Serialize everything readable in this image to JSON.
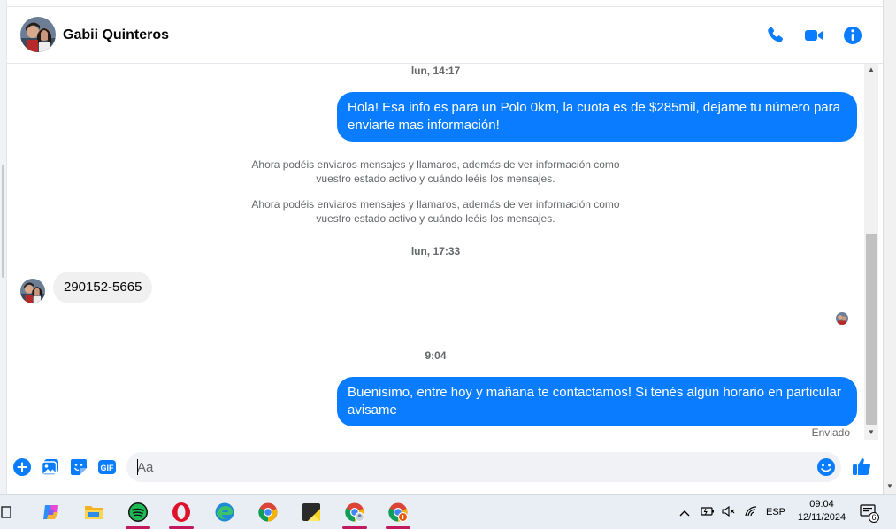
{
  "header": {
    "contact_name": "Gabii Quinteros",
    "accent_color": "#0a7cff",
    "icons": [
      "phone-icon",
      "video-camera-icon",
      "info-icon"
    ]
  },
  "conversation": {
    "timestamp_1": "lun, 14:17",
    "message_out_1": "Hola! Esa info es para un Polo 0km, la cuota es de $285mil, dejame tu número para enviarte mas información!",
    "system_1_line1": "Ahora podéis enviaros mensajes y llamaros, además de ver información como",
    "system_1_line2": "vuestro estado activo y cuándo leéis los mensajes.",
    "system_2_line1": "Ahora podéis enviaros mensajes y llamaros, además de ver información como",
    "system_2_line2": "vuestro estado activo y cuándo leéis los mensajes.",
    "timestamp_2": "lun, 17:33",
    "message_in_1": "290152-5665",
    "timestamp_3": "9:04",
    "message_out_2": "Buenisimo, entre hoy y mañana te contactamos! Si tenés algún horario en particular avisame",
    "status": "Enviado"
  },
  "composer": {
    "placeholder": "Aa",
    "buttons": [
      "plus-icon",
      "image-icon",
      "sticker-icon",
      "gif-icon",
      "emoji-icon",
      "like-icon"
    ],
    "gif_label": "GIF"
  },
  "taskbar": {
    "apps": [
      "task-view-icon",
      "copilot-icon",
      "file-explorer-icon",
      "spotify-icon",
      "opera-icon",
      "edge-icon",
      "chrome-icon",
      "sticky-notes-icon",
      "chrome-profile-1-icon",
      "chrome-profile-2-icon"
    ],
    "language": "ESP",
    "time": "09:04",
    "date": "12/11/2024",
    "notification_count": "6"
  }
}
